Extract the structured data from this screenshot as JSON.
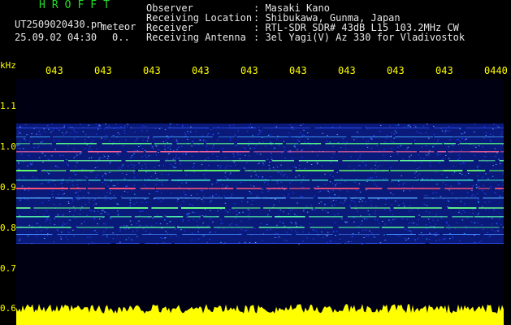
{
  "app": {
    "name": "HROFFT"
  },
  "file": {
    "name": "UT2509020430.pn",
    "type": "meteor",
    "datetime": "25.09.02 04:30",
    "value": "0.."
  },
  "info": [
    {
      "label": "Observer",
      "value": ": Masaki Kano"
    },
    {
      "label": "Receiving Location",
      "value": ": Shibukawa, Gunma, Japan"
    },
    {
      "label": "Receiver",
      "value": ": RTL-SDR SDR# 43dB L15 103.2MHz CW"
    },
    {
      "label": "Receiving Antenna",
      "value": ": 3el Yagi(V) Az 330 for Vladivostok"
    }
  ],
  "axis": {
    "unit": "kHz",
    "x_ticks": [
      "043",
      "043",
      "043",
      "043",
      "043",
      "043",
      "043",
      "043",
      "043",
      "0440"
    ],
    "y_ticks": [
      "1.1",
      "1.0",
      "0.9",
      "0.8",
      "0.7",
      "0.6"
    ]
  },
  "colors": {
    "header_text": "#e8e8e8",
    "app_title": "#22dd22",
    "axis_text": "#ffff00",
    "plot_background": "#000013"
  }
}
